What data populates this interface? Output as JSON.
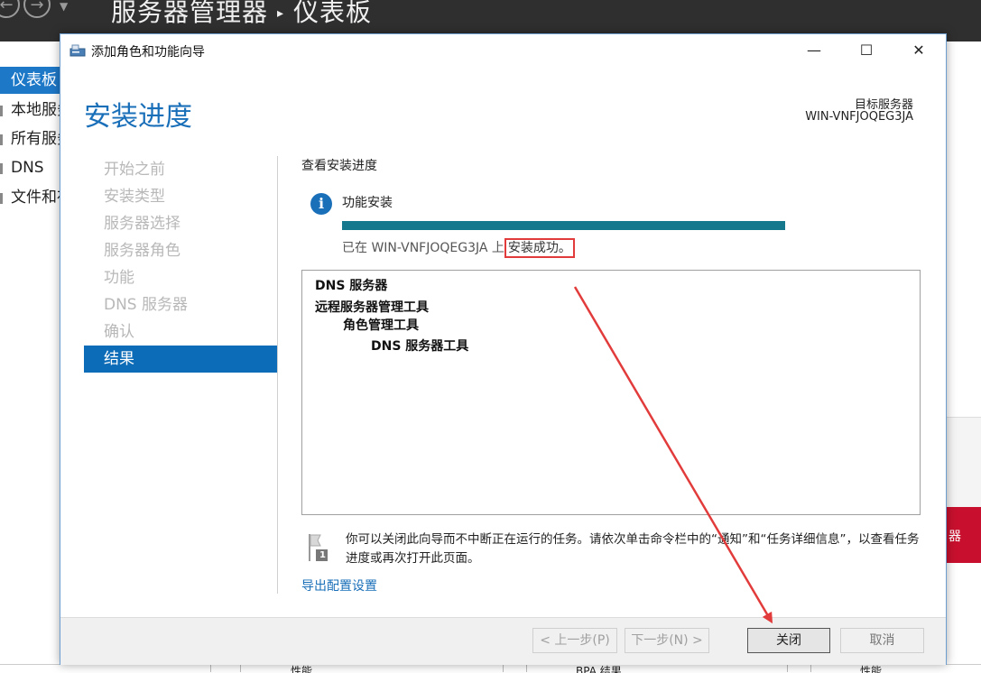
{
  "server_manager": {
    "title": "服务器管理器",
    "breadcrumb_sep": "▸",
    "page": "仪表板",
    "sidebar": [
      "仪表板",
      "本地服务器",
      "所有服务器",
      "DNS",
      "文件和存储服务"
    ],
    "bottom_labels": [
      "性能",
      "BPA 结果",
      "性能"
    ],
    "right_edge_text": "器"
  },
  "wizard": {
    "title": "添加角色和功能向导",
    "heading": "安装进度",
    "target_label": "目标服务器",
    "target_server": "WIN-VNFJOQEG3JA",
    "steps": [
      {
        "label": "开始之前",
        "active": false
      },
      {
        "label": "安装类型",
        "active": false
      },
      {
        "label": "服务器选择",
        "active": false
      },
      {
        "label": "服务器角色",
        "active": false
      },
      {
        "label": "功能",
        "active": false
      },
      {
        "label": "DNS 服务器",
        "active": false
      },
      {
        "label": "确认",
        "active": false
      },
      {
        "label": "结果",
        "active": true
      }
    ],
    "view_label": "查看安装进度",
    "feature_label": "功能安装",
    "progress": 1.0,
    "status_prefix": "已在 WIN-VNFJOQEG3JA 上",
    "status_result": "安装成功。",
    "results": [
      {
        "text": "DNS 服务器",
        "level": 0
      },
      {
        "text": "远程服务器管理工具",
        "level": 0
      },
      {
        "text": "角色管理工具",
        "level": 1
      },
      {
        "text": "DNS 服务器工具",
        "level": 2
      }
    ],
    "flag_number": "1",
    "note": "你可以关闭此向导而不中断正在运行的任务。请依次单击命令栏中的“通知”和“任务详细信息”，以查看任务进度或再次打开此页面。",
    "export_link": "导出配置设置",
    "buttons": {
      "prev": "< 上一步(P)",
      "next": "下一步(N) >",
      "close": "关闭",
      "cancel": "取消"
    },
    "window_controls": {
      "minimize": "—",
      "maximize": "☐",
      "close": "✕"
    }
  },
  "colors": {
    "accent": "#1a6fb9",
    "progress": "#16788c",
    "annotation": "#e23b3b",
    "header_bg": "#2f2f2f"
  }
}
